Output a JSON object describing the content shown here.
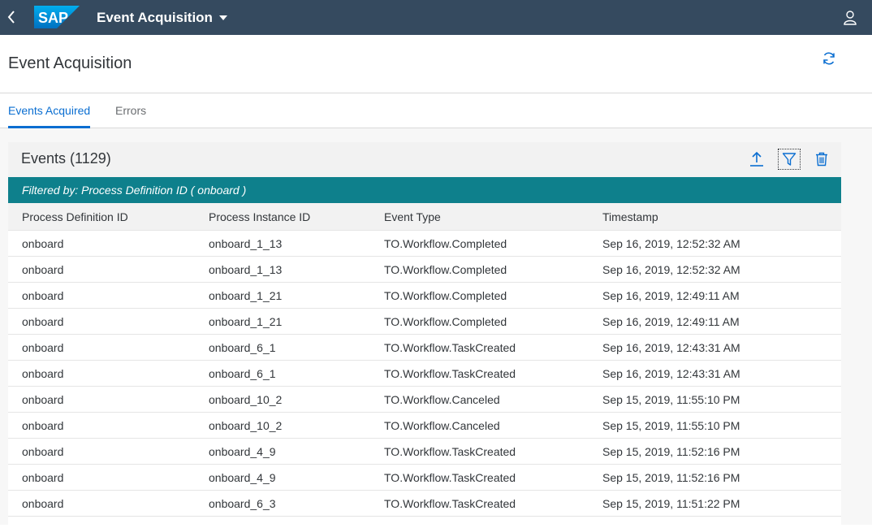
{
  "shell": {
    "app_title": "Event Acquisition",
    "logo_text": "SAP",
    "brand_color": "#354a5f",
    "icons": {
      "back": "back-icon",
      "dropdown": "chevron-down-icon",
      "user": "user-icon"
    }
  },
  "page": {
    "title": "Event Acquisition",
    "refresh_icon": "refresh-icon"
  },
  "tabs": [
    {
      "label": "Events Acquired",
      "active": true
    },
    {
      "label": "Errors",
      "active": false
    }
  ],
  "table": {
    "title": "Events (1129)",
    "filter_text": "Filtered by: Process Definition ID ( onboard )",
    "accent_color": "#0e808c",
    "toolbar_icons": [
      "upload-icon",
      "filter-icon",
      "delete-icon"
    ],
    "columns": [
      "Process Definition ID",
      "Process Instance ID",
      "Event Type",
      "Timestamp"
    ],
    "rows": [
      [
        "onboard",
        "onboard_1_13",
        "TO.Workflow.Completed",
        "Sep 16, 2019, 12:52:32 AM"
      ],
      [
        "onboard",
        "onboard_1_13",
        "TO.Workflow.Completed",
        "Sep 16, 2019, 12:52:32 AM"
      ],
      [
        "onboard",
        "onboard_1_21",
        "TO.Workflow.Completed",
        "Sep 16, 2019, 12:49:11 AM"
      ],
      [
        "onboard",
        "onboard_1_21",
        "TO.Workflow.Completed",
        "Sep 16, 2019, 12:49:11 AM"
      ],
      [
        "onboard",
        "onboard_6_1",
        "TO.Workflow.TaskCreated",
        "Sep 16, 2019, 12:43:31 AM"
      ],
      [
        "onboard",
        "onboard_6_1",
        "TO.Workflow.TaskCreated",
        "Sep 16, 2019, 12:43:31 AM"
      ],
      [
        "onboard",
        "onboard_10_2",
        "TO.Workflow.Canceled",
        "Sep 15, 2019, 11:55:10 PM"
      ],
      [
        "onboard",
        "onboard_10_2",
        "TO.Workflow.Canceled",
        "Sep 15, 2019, 11:55:10 PM"
      ],
      [
        "onboard",
        "onboard_4_9",
        "TO.Workflow.TaskCreated",
        "Sep 15, 2019, 11:52:16 PM"
      ],
      [
        "onboard",
        "onboard_4_9",
        "TO.Workflow.TaskCreated",
        "Sep 15, 2019, 11:52:16 PM"
      ],
      [
        "onboard",
        "onboard_6_3",
        "TO.Workflow.TaskCreated",
        "Sep 15, 2019, 11:51:22 PM"
      ]
    ]
  }
}
